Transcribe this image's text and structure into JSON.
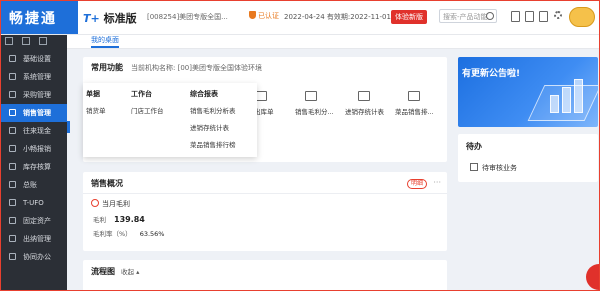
{
  "header": {
    "logo": "畅捷通",
    "brand_prefix": "T+",
    "brand_name": "标准版",
    "org_line": "[008254]美团专版全国...",
    "auth_label": "已认证",
    "dates": "2022-04-24  有效期:2022-11-01",
    "trial_button": "体验新版",
    "search_placeholder": "搜索-产品动能"
  },
  "sidebar": {
    "items": [
      {
        "label": "基础设置"
      },
      {
        "label": "系统管理"
      },
      {
        "label": "采购管理"
      },
      {
        "label": "销售管理"
      },
      {
        "label": "往来现金"
      },
      {
        "label": "小畅报销"
      },
      {
        "label": "库存核算"
      },
      {
        "label": "总账"
      },
      {
        "label": "T-UFO"
      },
      {
        "label": "固定资产"
      },
      {
        "label": "出纳管理"
      },
      {
        "label": "协同办公"
      }
    ]
  },
  "tabbar": {
    "active_tab": "我的桌面"
  },
  "quick": {
    "title": "常用功能",
    "org_label": "当前机构名称:  [00]美团专版全国体验环境",
    "items": [
      {
        "label": "销售出库单"
      },
      {
        "label": "销售毛利分..."
      },
      {
        "label": "进销存统计表"
      },
      {
        "label": "菜品销售排..."
      }
    ]
  },
  "dropdown": {
    "columns": [
      {
        "header": "单据",
        "rows": [
          "销货单"
        ]
      },
      {
        "header": "工作台",
        "rows": [
          "门店工作台"
        ]
      },
      {
        "header": "综合报表",
        "rows": [
          "销售毛利分析表",
          "进销存统计表",
          "菜品销售排行榜"
        ]
      }
    ]
  },
  "banner": {
    "text": "有更新公告啦!"
  },
  "todo": {
    "title": "待办",
    "item": "待审核业务"
  },
  "sales": {
    "title": "销售概况",
    "detail_button": "明细",
    "more": "···",
    "sub_head": "当月毛利",
    "gross_profit_label": "毛利",
    "gross_profit_value": "139.84",
    "gross_margin_label": "毛利率（%）",
    "gross_margin_value": "63.56%"
  },
  "flow": {
    "title": "流程图",
    "collapse_label": "收起 ▴"
  }
}
